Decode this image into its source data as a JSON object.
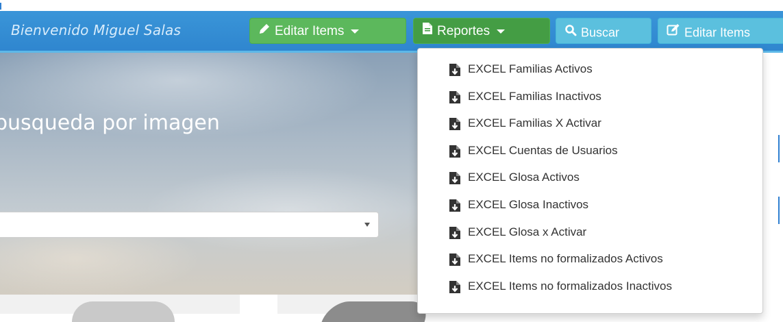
{
  "navbar": {
    "welcome": "Bienvenido Miguel Salas",
    "edit_items_menu": {
      "label": "Editar Items",
      "icon": "pencil-icon"
    },
    "reports_menu": {
      "label": "Reportes",
      "icon": "file-icon"
    },
    "search_button": {
      "label": "Buscar",
      "icon": "search-icon"
    },
    "edit_items_button": {
      "label": "Editar Items",
      "icon": "edit-square-icon"
    }
  },
  "hero": {
    "title": "busqueda por imagen",
    "select": {
      "value": ""
    }
  },
  "reports_dropdown": {
    "icon": "file-download-icon",
    "items": [
      {
        "label": "EXCEL Familias Activos"
      },
      {
        "label": "EXCEL Familias Inactivos"
      },
      {
        "label": "EXCEL Familias X Activar"
      },
      {
        "label": "EXCEL Cuentas de Usuarios"
      },
      {
        "label": "EXCEL Glosa Activos"
      },
      {
        "label": "EXCEL Glosa Inactivos"
      },
      {
        "label": "EXCEL Glosa x Activar"
      },
      {
        "label": "EXCEL Items no formalizados Activos"
      },
      {
        "label": "EXCEL Items no formalizados Inactivos"
      }
    ]
  },
  "colors": {
    "navbar": "#2f86cf",
    "success": "#5cb85c",
    "info": "#5bc0de"
  }
}
